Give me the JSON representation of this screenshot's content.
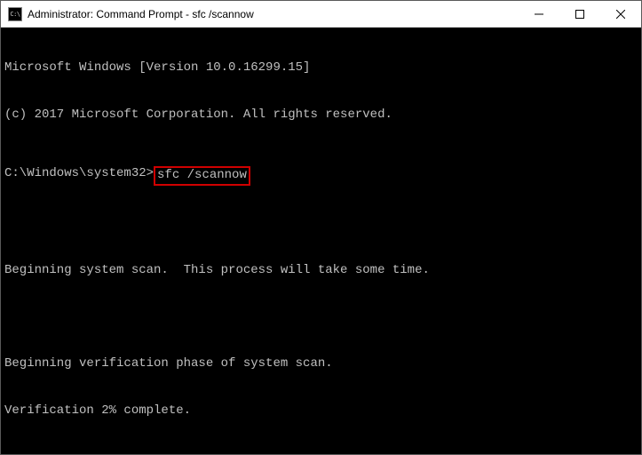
{
  "window": {
    "icon_text": "C:\\",
    "title": "Administrator: Command Prompt - sfc  /scannow"
  },
  "terminal": {
    "line1": "Microsoft Windows [Version 10.0.16299.15]",
    "line2": "(c) 2017 Microsoft Corporation. All rights reserved.",
    "prompt": "C:\\Windows\\system32>",
    "command": "sfc /scannow",
    "line3": "Beginning system scan.  This process will take some time.",
    "line4": "Beginning verification phase of system scan.",
    "line5": "Verification 2% complete."
  }
}
